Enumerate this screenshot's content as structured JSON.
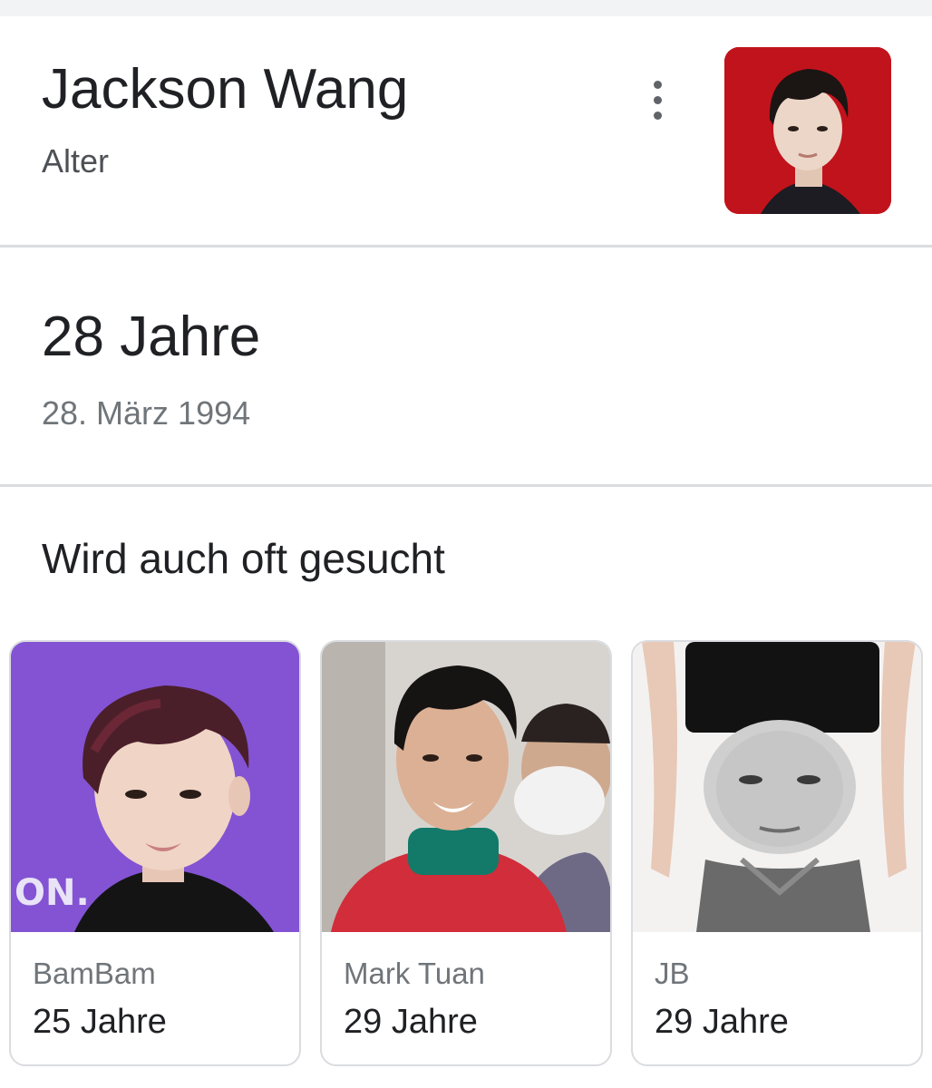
{
  "header": {
    "title": "Jackson Wang",
    "subtitle": "Alter"
  },
  "answer": {
    "value": "28 Jahre",
    "birth_date": "28. März 1994"
  },
  "related": {
    "title": "Wird auch oft gesucht",
    "people": [
      {
        "name": "BamBam",
        "age": "25 Jahre",
        "photo_text": "ON."
      },
      {
        "name": "Mark Tuan",
        "age": "29 Jahre"
      },
      {
        "name": "JB",
        "age": "29 Jahre"
      }
    ]
  },
  "icons": {
    "more": "more-vert-icon"
  },
  "colors": {
    "text_primary": "#202124",
    "text_secondary": "#70757a",
    "divider": "#dadce0",
    "thumb_bg": "#c8141e",
    "bambam_bg": "#8a5ad8"
  }
}
